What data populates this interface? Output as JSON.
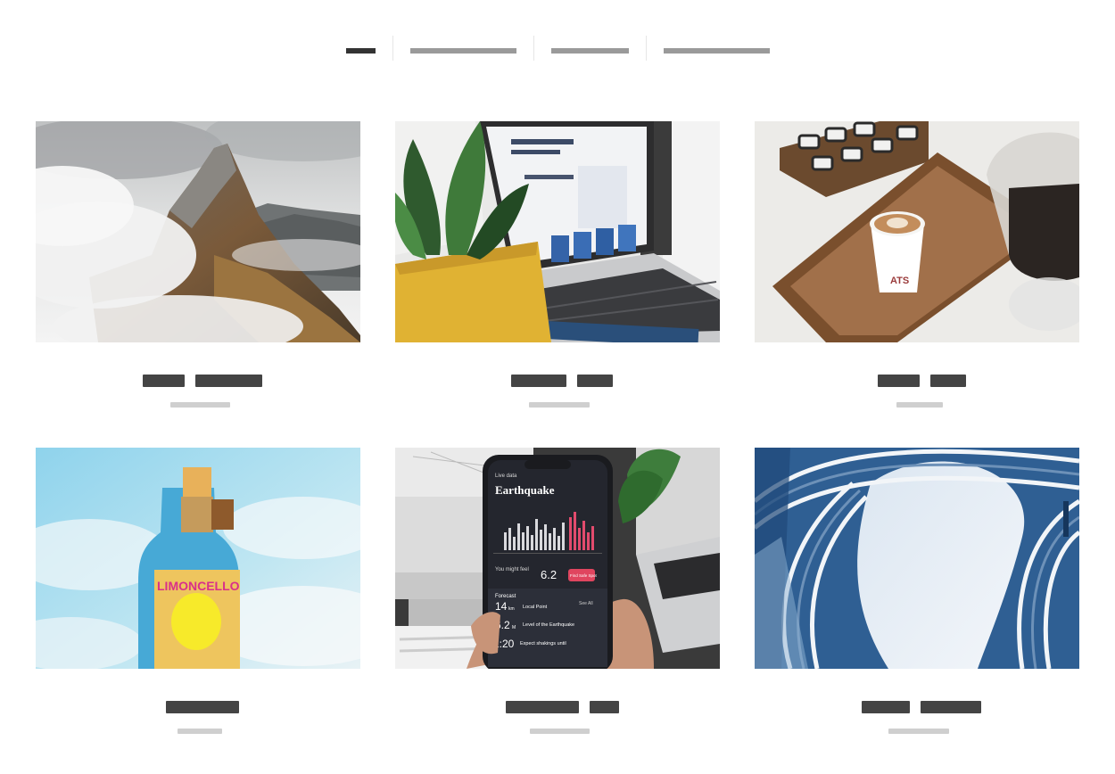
{
  "filters": {
    "items": [
      {
        "id": "all",
        "active": true
      },
      {
        "id": "filter-2",
        "active": false
      },
      {
        "id": "filter-3",
        "active": false
      },
      {
        "id": "filter-4",
        "active": false
      }
    ],
    "active_color": "#333333",
    "inactive_color": "#9a9a9a"
  },
  "gallery": {
    "items": [
      {
        "image": "mountain-clouds-photo"
      },
      {
        "image": "laptop-plant-photo"
      },
      {
        "image": "coffee-tray-photo"
      },
      {
        "image": "limoncello-bottle-photo"
      },
      {
        "image": "phone-earthquake-app-photo",
        "phone": {
          "header": "Live data",
          "title": "Earthquake",
          "might_feel_label": "You might feel",
          "might_feel_value": "6.2",
          "button": "Find Safe Spot",
          "forecast_label": "Forecast",
          "see_all": "See All",
          "row1_value": "14",
          "row1_unit": "km",
          "row1_label": "Local Point",
          "row2_value": "6.2",
          "row2_unit": "M",
          "row2_label": "Level of the Earthquake",
          "row3_value": "1:20",
          "row3_label": "Expect shakings until"
        }
      },
      {
        "image": "curved-architecture-photo"
      }
    ]
  },
  "visible_text": {
    "coffee_cup": "ATS",
    "bottle_label": "LIMONCELLO"
  },
  "colors": {
    "title_placeholder": "#444444",
    "subtitle_placeholder": "#cfcfcf"
  }
}
